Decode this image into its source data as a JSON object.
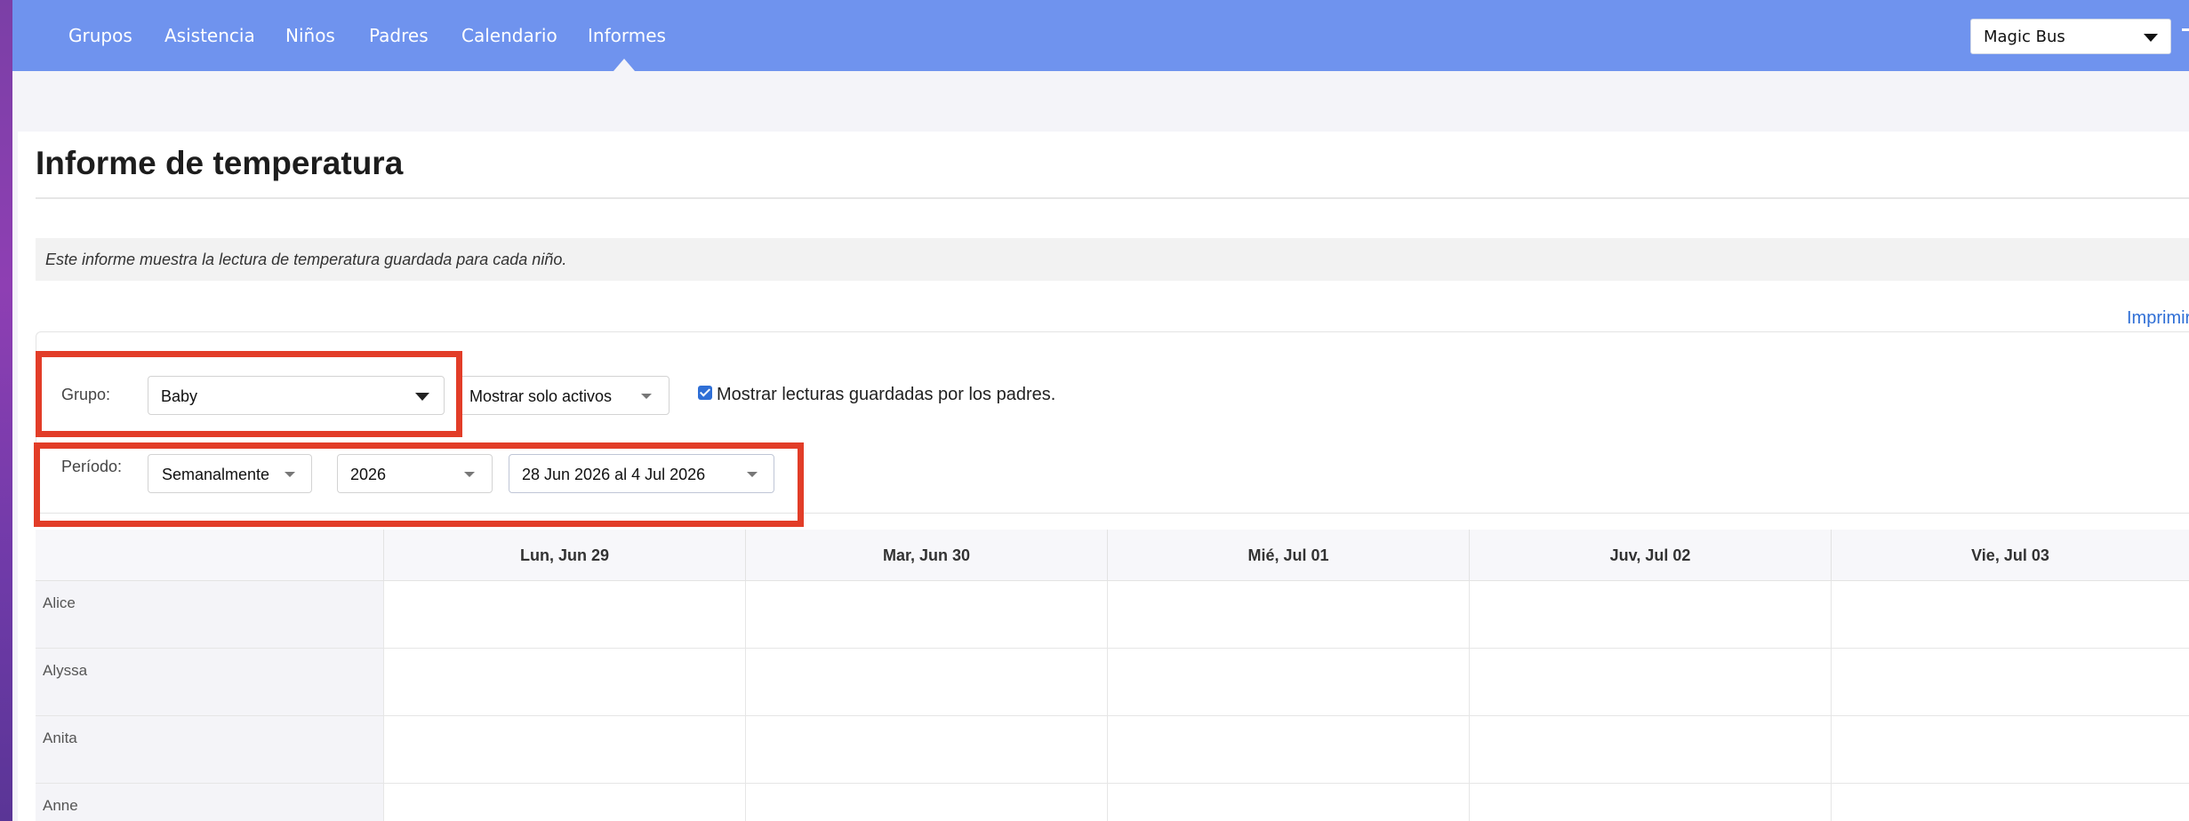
{
  "nav": {
    "items": [
      "Grupos",
      "Asistencia",
      "Niños",
      "Padres",
      "Calendario",
      "Informes"
    ],
    "active": "Informes",
    "org_selector": "Magic Bus"
  },
  "page": {
    "title": "Informe de temperatura",
    "description": "Este informe muestra la lectura de temperatura guardada para cada niño.",
    "print_link": "Imprimir"
  },
  "filters": {
    "group_label": "Grupo:",
    "group_value": "Baby",
    "status_value": "Mostrar solo activos",
    "show_parent_readings_label": "Mostrar lecturas guardadas por los padres.",
    "show_parent_readings_checked": true,
    "period_label": "Período:",
    "period_value": "Semanalmente",
    "year_value": "2026",
    "range_value": "28 Jun 2026 al 4 Jul 2026"
  },
  "table": {
    "columns": [
      "Lun, Jun 29",
      "Mar, Jun 30",
      "Mié, Jul 01",
      "Juv, Jul 02",
      "Vie, Jul 03"
    ],
    "rows": [
      "Alice",
      "Alyssa",
      "Anita",
      "Anne"
    ]
  },
  "colors": {
    "nav_bg": "#6f93ee",
    "highlight": "#e23d28",
    "link": "#2f6fd6"
  }
}
